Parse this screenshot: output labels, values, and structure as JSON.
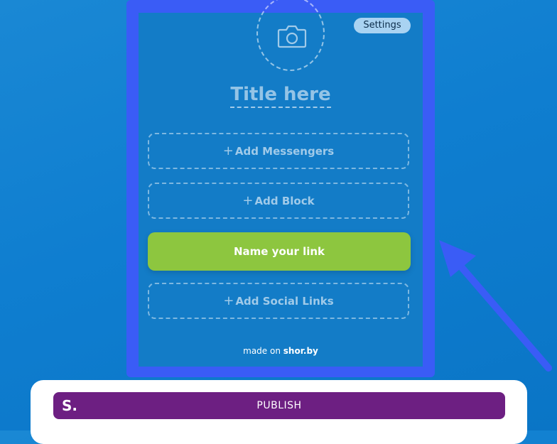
{
  "editor": {
    "settings_label": "Settings",
    "title_placeholder": "Title here",
    "add_messengers_label": "Add Messengers",
    "add_block_label": "Add Block",
    "link_button_label": "Name your link",
    "add_social_label": "Add Social Links",
    "footer_prefix": "made on",
    "footer_brand": "shor.by",
    "plus_glyph": "+"
  },
  "publish_bar": {
    "brand": "S.",
    "label": "PUBLISH"
  },
  "colors": {
    "background": "#137cc7",
    "highlight_frame": "#3a5cf6",
    "link_button": "#8dc63f",
    "publish_bar": "#6d1f82",
    "settings_pill": "#a9d3f2"
  },
  "icons": [
    "camera-icon",
    "plus-icon",
    "arrow-pointer-icon"
  ]
}
